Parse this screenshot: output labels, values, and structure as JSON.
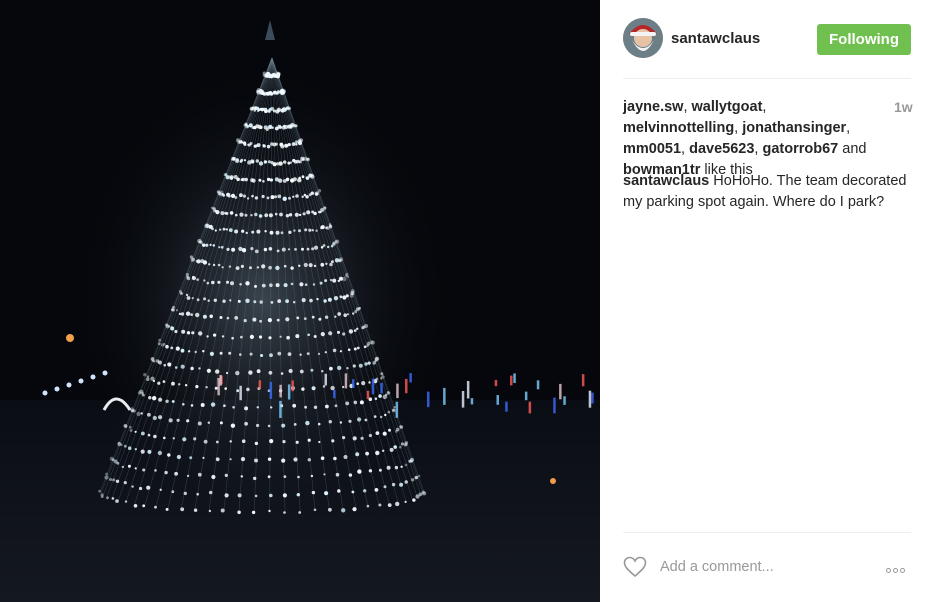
{
  "post": {
    "image_alt": "Christmas light tree at night",
    "author": {
      "username": "santawclaus",
      "follow_label": "Following",
      "avatar_icon": "santa-avatar"
    },
    "likes": {
      "users": [
        "jayne.sw",
        "wallytgoat",
        "melvinnottelling",
        "jonathansinger",
        "mm0051",
        "dave5623",
        "gatorrob67",
        "bowman1tr"
      ],
      "separator": ", ",
      "and_text": " and ",
      "suffix": " like this"
    },
    "timestamp": "1w",
    "caption": {
      "username": "santawclaus",
      "text": "HoHoHo. The team decorated my parking spot again. Where do I park?"
    },
    "comment_box": {
      "placeholder": "Add a comment..."
    }
  },
  "colors": {
    "follow_button": "#70c050",
    "photo_background": "#05070c"
  }
}
